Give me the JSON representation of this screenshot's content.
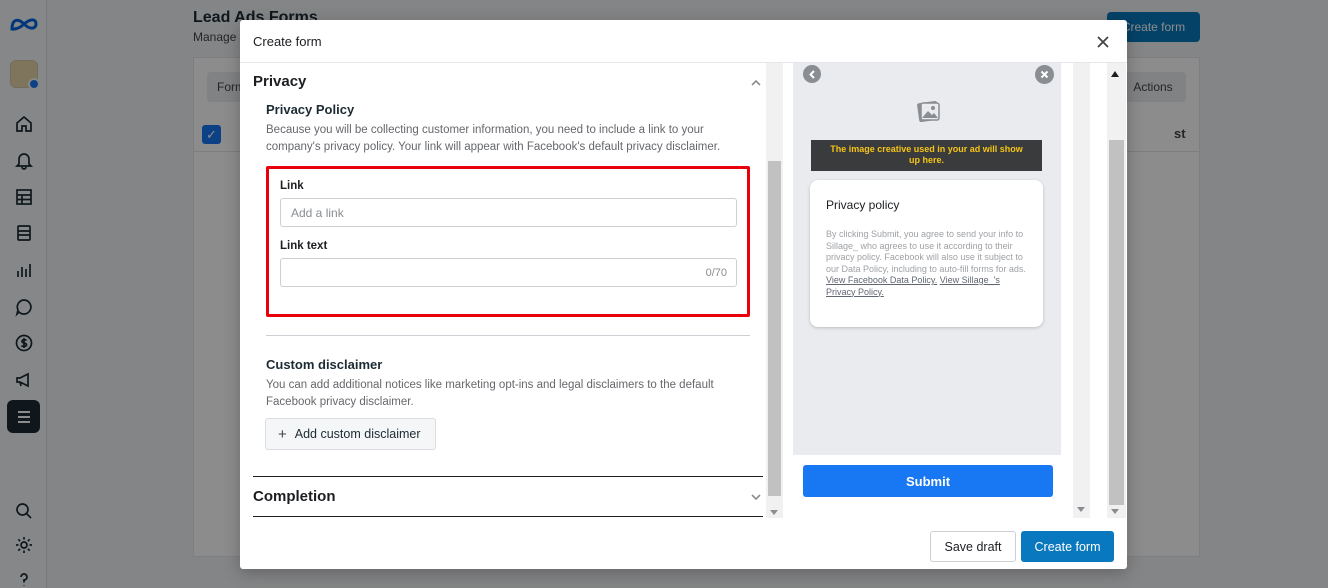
{
  "background": {
    "page_title": "Lead Ads Forms",
    "page_subtitle": "Manage f",
    "create_button_label": "Create form",
    "tab_label": "Form",
    "actions_label": "Actions",
    "column_header": "st"
  },
  "modal": {
    "title": "Create form",
    "privacy": {
      "section_title": "Privacy",
      "policy_title": "Privacy Policy",
      "policy_description": "Because you will be collecting customer information, you need to include a link to your company's privacy policy. Your link will appear with Facebook's default privacy disclaimer.",
      "link_label": "Link",
      "link_placeholder": "Add a link",
      "link_value": "",
      "link_text_label": "Link text",
      "link_text_value": "",
      "link_text_counter": "0/70",
      "custom_disclaimer_title": "Custom disclaimer",
      "custom_disclaimer_description": "You can add additional notices like marketing opt-ins and legal disclaimers to the default Facebook privacy disclaimer.",
      "add_custom_disclaimer_label": "Add custom disclaimer"
    },
    "completion": {
      "section_title": "Completion"
    },
    "preview": {
      "image_notice": "The image creative used in your ad will show up here.",
      "card_title": "Privacy policy",
      "card_text": "By clicking Submit, you agree to send your info to Sillage_ who agrees to use it according to their privacy policy. Facebook will also use it subject to our Data Policy, including to auto-fill forms for ads.",
      "card_link_1": "View Facebook Data Policy.",
      "card_link_2": "View Sillage_'s Privacy Policy.",
      "submit_label": "Submit"
    },
    "footer": {
      "save_draft_label": "Save draft",
      "create_form_label": "Create form"
    }
  },
  "colors": {
    "accent": "#0a78be",
    "submit_blue": "#1877f2",
    "highlight_red": "#e8000b",
    "rail_active": "#1c2b33"
  },
  "icons": {
    "rail": [
      "meta-logo-icon",
      "account-avatar",
      "home-icon",
      "notifications-icon",
      "table-icon",
      "pages-icon",
      "insights-icon",
      "messages-icon",
      "billing-icon",
      "ads-icon",
      "menu-icon",
      "search-icon",
      "settings-icon",
      "help-icon"
    ]
  }
}
